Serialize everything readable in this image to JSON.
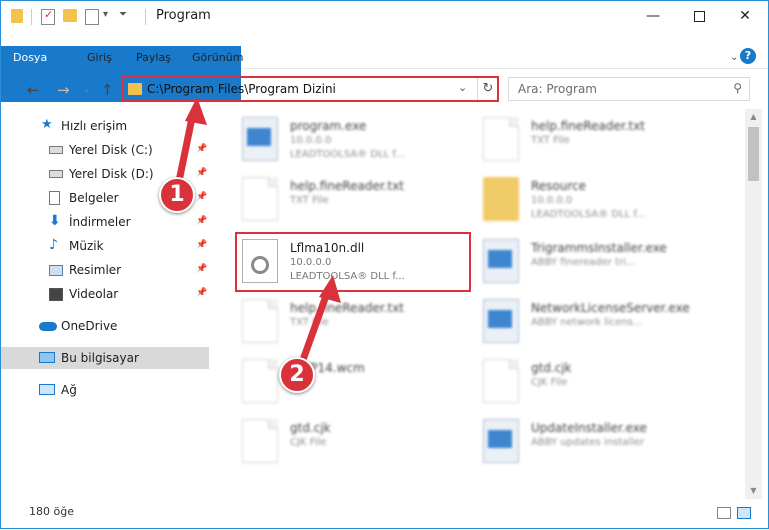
{
  "window": {
    "title": "Program"
  },
  "ribbon": {
    "tabs": [
      "Dosya",
      "Giriş",
      "Paylaş",
      "Görünüm"
    ],
    "help": "?"
  },
  "address": {
    "path": "C:\\Program Files\\Program Dizini"
  },
  "search": {
    "placeholder": "Ara: Program"
  },
  "sidebar": {
    "items": [
      {
        "label": "Hızlı erişim",
        "icon": "star-icon"
      },
      {
        "label": "Yerel Disk (C:)",
        "icon": "drive-icon"
      },
      {
        "label": "Yerel Disk (D:)",
        "icon": "drive-icon"
      },
      {
        "label": "Belgeler",
        "icon": "documents-icon"
      },
      {
        "label": "İndirmeler",
        "icon": "download-icon"
      },
      {
        "label": "Müzik",
        "icon": "music-icon"
      },
      {
        "label": "Resimler",
        "icon": "pictures-icon"
      },
      {
        "label": "Videolar",
        "icon": "videos-icon"
      },
      {
        "label": "OneDrive",
        "icon": "cloud-icon"
      },
      {
        "label": "Bu bilgisayar",
        "icon": "computer-icon"
      },
      {
        "label": "Ağ",
        "icon": "network-icon"
      }
    ]
  },
  "files": [
    {
      "name": "program.exe",
      "s1": "10.0.0.0",
      "s2": "LEADTOOLSA® DLL f..."
    },
    {
      "name": "help.fineReader.txt",
      "s1": "TXT File",
      "s2": ""
    },
    {
      "name": "help.fineReader.txt",
      "s1": "TXT File",
      "s2": ""
    },
    {
      "name": "Resource",
      "s1": "10.0.0.0",
      "s2": "LEADTOOLSA® DLL f..."
    },
    {
      "name": "Lflma10n.dll",
      "s1": "10.0.0.0",
      "s2": "LEADTOOLSA® DLL f..."
    },
    {
      "name": "TrigrammsInstaller.exe",
      "s1": "ABBY finereader tri...",
      "s2": ""
    },
    {
      "name": "help.fineReader.txt",
      "s1": "TXT File",
      "s2": ""
    },
    {
      "name": "NetworkLicenseServer.exe",
      "s1": "ABBY network licens...",
      "s2": ""
    },
    {
      "name": "CWP14.wcm",
      "s1": "",
      "s2": ""
    },
    {
      "name": "gtd.cjk",
      "s1": "CJK File",
      "s2": ""
    },
    {
      "name": "gtd.cjk",
      "s1": "CJK File",
      "s2": ""
    },
    {
      "name": "UpdateInstaller.exe",
      "s1": "ABBY updates installer",
      "s2": ""
    }
  ],
  "status": {
    "count": "180 öğe"
  },
  "callouts": [
    "1",
    "2"
  ],
  "colors": {
    "accent": "#1979ca",
    "highlight": "#d9323a"
  }
}
